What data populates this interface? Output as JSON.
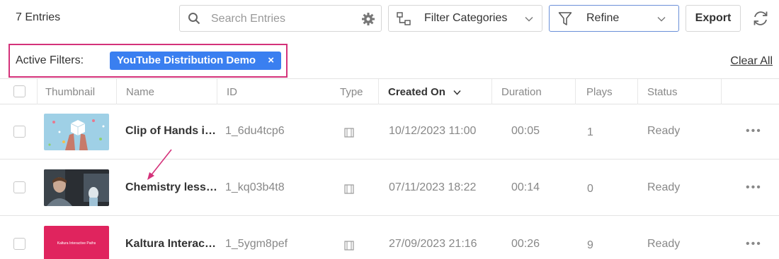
{
  "toolbar": {
    "entries_count": "7 Entries",
    "search_placeholder": "Search Entries",
    "filter_categories_label": "Filter Categories",
    "refine_label": "Refine",
    "export_label": "Export"
  },
  "filters": {
    "label": "Active Filters:",
    "tag": "YouTube Distribution Demo",
    "tag_remove": "×",
    "clear_all": "Clear All"
  },
  "columns": {
    "thumbnail": "Thumbnail",
    "name": "Name",
    "id": "ID",
    "type": "Type",
    "created_on": "Created On",
    "duration": "Duration",
    "plays": "Plays",
    "status": "Status"
  },
  "rows": [
    {
      "name": "Clip of Hands i…",
      "id": "1_6du4tcp6",
      "created_on": "10/12/2023 11:00",
      "duration": "00:05",
      "plays": "1",
      "status": "Ready",
      "more": "•••"
    },
    {
      "name": "Chemistry less…",
      "id": "1_kq03b4t8",
      "created_on": "07/11/2023 18:22",
      "duration": "00:14",
      "plays": "0",
      "status": "Ready",
      "more": "•••"
    },
    {
      "name": "Kaltura Interac…",
      "id": "1_5ygm8pef",
      "created_on": "27/09/2023 21:16",
      "duration": "00:26",
      "plays": "9",
      "status": "Ready",
      "more": "•••",
      "thumb_text": "Kaltura Interactive Paths"
    }
  ],
  "colors": {
    "accent": "#3a7ff0",
    "highlight": "#d4327a",
    "thumb3_bg": "#e0245e"
  }
}
